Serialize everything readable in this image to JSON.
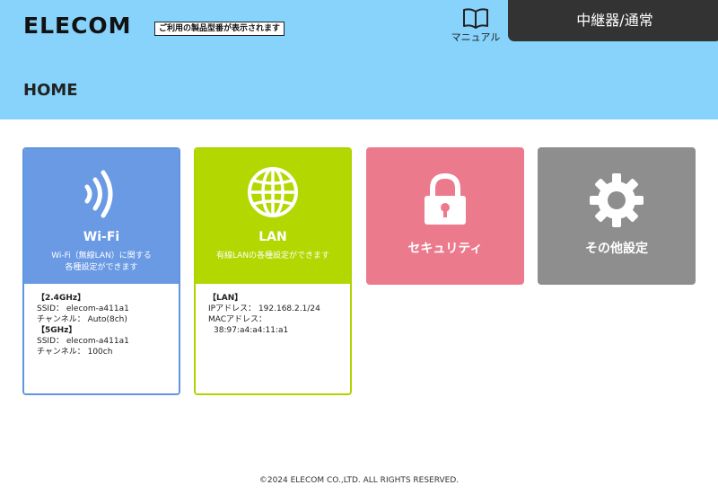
{
  "header": {
    "logo": "ELECOM",
    "model_note": "ご利用の製品型番が表示されます",
    "manual_label": "マニュアル",
    "mode": "中継器/通常",
    "page_title": "HOME"
  },
  "cards": {
    "wifi": {
      "title": "Wi-Fi",
      "desc1": "Wi-Fi（無線LAN）に関する",
      "desc2": "各種設定ができます",
      "band24_heading": "【2.4GHz】",
      "band24_ssid": "SSID：  elecom-a411a1",
      "band24_channel": "チャンネル：  Auto(8ch)",
      "band5_heading": "【5GHz】",
      "band5_ssid": "SSID：  elecom-a411a1",
      "band5_channel": "チャンネル：  100ch"
    },
    "lan": {
      "title": "LAN",
      "desc": "有線LANの各種設定ができます",
      "heading": "【LAN】",
      "ip": "IPアドレス：  192.168.2.1/24",
      "mac_label": "MACアドレス：",
      "mac": "38:97:a4:a4:11:a1"
    },
    "security": {
      "title": "セキュリティ"
    },
    "other": {
      "title": "その他設定"
    }
  },
  "footer": "©2024 ELECOM CO.,LTD. ALL RIGHTS RESERVED.",
  "colors": {
    "header_bg": "#87d3fb",
    "wifi": "#6a9ae4",
    "lan": "#b3d700",
    "security": "#ec7a8d",
    "other": "#8e8e8e",
    "mode_tab": "#333333"
  },
  "icons": {
    "wifi": "wifi-waves-icon",
    "lan": "globe-icon",
    "security": "padlock-icon",
    "other": "gear-icon",
    "manual": "book-icon"
  }
}
